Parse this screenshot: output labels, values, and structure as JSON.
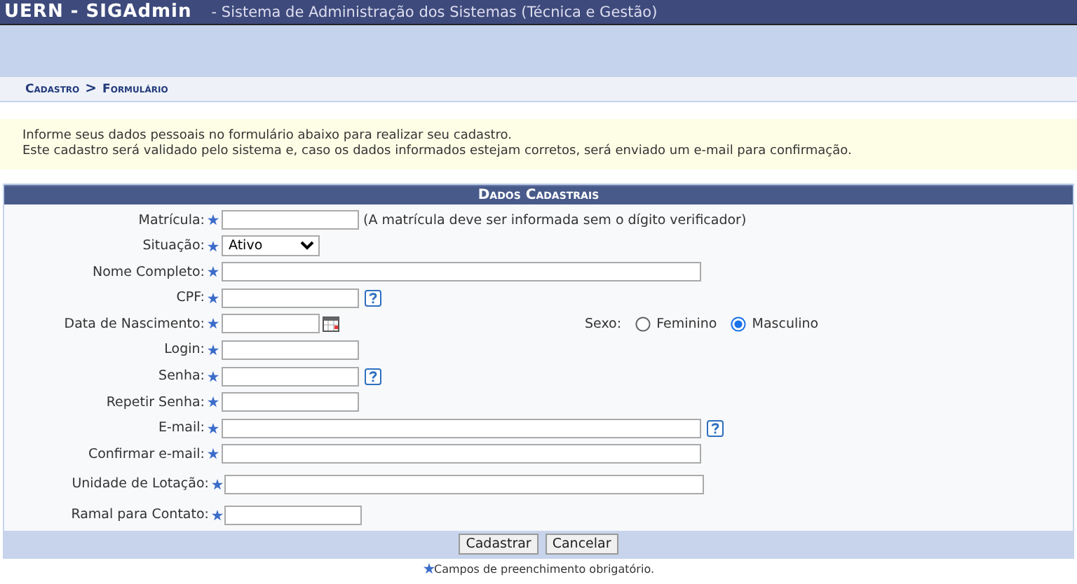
{
  "header": {
    "brand": "UERN - SIGAdmin",
    "subtitle": "- Sistema de Administração dos Sistemas (Técnica e Gestão)"
  },
  "breadcrumb": [
    "Cadastro",
    ">",
    "Formulário"
  ],
  "info": [
    "Informe seus dados pessoais no formulário abaixo para realizar seu cadastro.",
    "Este cadastro será validado pelo sistema e, caso os dados informados estejam corretos, será enviado um e-mail para confirmação."
  ],
  "form": {
    "title": "Dados Cadastrais",
    "fields": [
      {
        "label": "Matrícula:",
        "kind": "short",
        "required": true,
        "note": "(A matrícula deve ser informada sem o dígito verificador)"
      },
      {
        "label": "Situação:",
        "kind": "select",
        "required": true,
        "value": "Ativo"
      },
      {
        "label": "Nome Completo:",
        "kind": "long",
        "required": true
      },
      {
        "label": "CPF:",
        "kind": "short",
        "required": true,
        "help": true
      },
      {
        "label": "Data de Nascimento:",
        "kind": "date",
        "required": true,
        "sex": {
          "label": "Sexo:",
          "options": [
            {
              "label": "Feminino",
              "selected": false
            },
            {
              "label": "Masculino",
              "selected": true
            }
          ]
        }
      },
      {
        "label": "Login:",
        "kind": "short",
        "required": true
      },
      {
        "label": "Senha:",
        "kind": "short",
        "required": true,
        "help": true
      },
      {
        "label": "Repetir Senha:",
        "kind": "short",
        "required": true
      },
      {
        "label": "E-mail:",
        "kind": "long",
        "required": true,
        "help": true
      },
      {
        "label": "Confirmar e-mail:",
        "kind": "long",
        "required": true
      },
      {
        "label": "Unidade de Lotação:",
        "kind": "long",
        "required": true
      },
      {
        "label": "Ramal para Contato:",
        "kind": "short",
        "required": true
      }
    ],
    "buttons": [
      "Cadastrar",
      "Cancelar"
    ]
  },
  "footnote": "Campos de preenchimento obrigatório."
}
